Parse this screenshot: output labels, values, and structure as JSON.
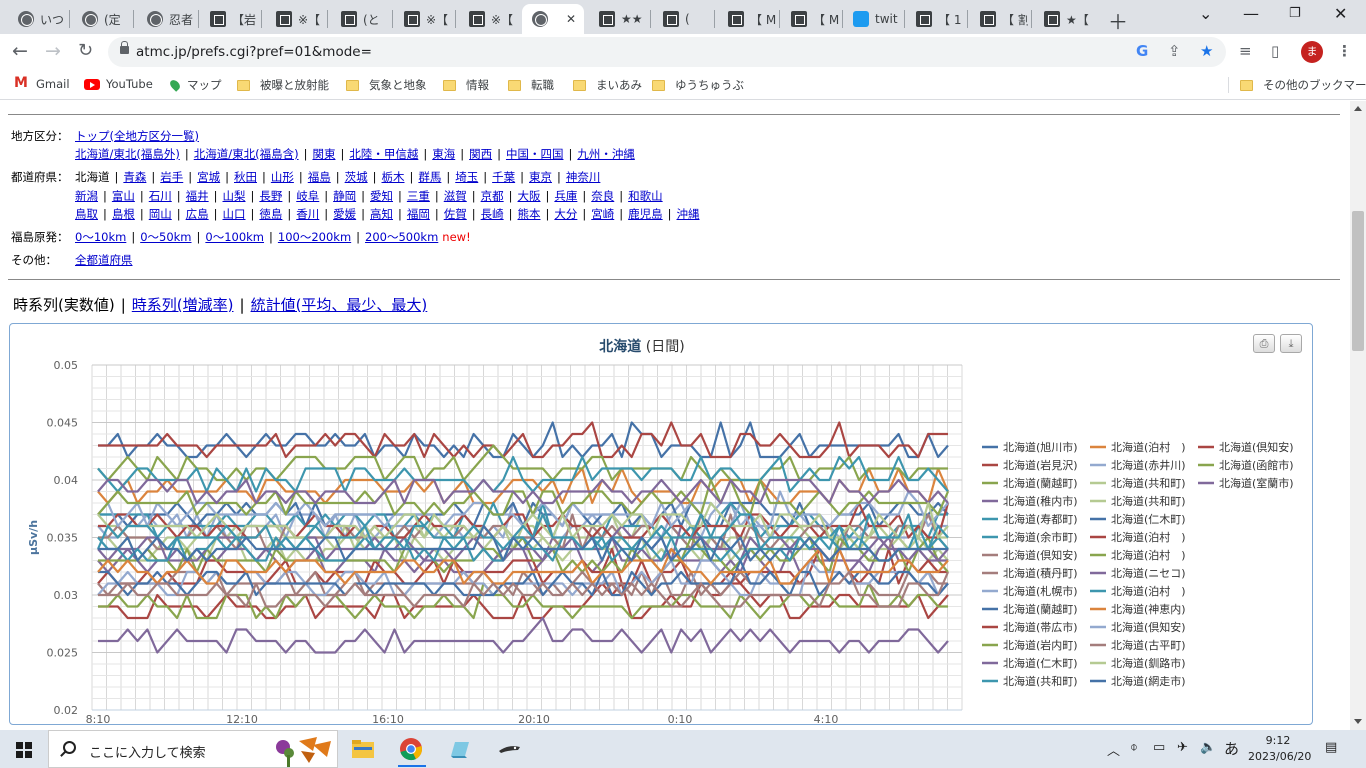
{
  "browser": {
    "tabs": [
      {
        "label": "いつ",
        "icon": "globe-icon"
      },
      {
        "label": "(定",
        "icon": "globe-icon"
      },
      {
        "label": "忍者",
        "icon": "globe-icon"
      },
      {
        "label": "【岩",
        "icon": "site-icon"
      },
      {
        "label": "※【",
        "icon": "site-icon"
      },
      {
        "label": "(と",
        "icon": "site-icon"
      },
      {
        "label": "※【",
        "icon": "site-icon"
      },
      {
        "label": "※【",
        "icon": "site-icon"
      },
      {
        "label": "",
        "icon": "globe-icon",
        "active": true
      },
      {
        "label": "★★",
        "icon": "site-icon"
      },
      {
        "label": "(",
        "icon": "site-icon"
      },
      {
        "label": "【 M",
        "icon": "site-icon"
      },
      {
        "label": "【 M",
        "icon": "site-icon"
      },
      {
        "label": "twit",
        "icon": "twitter-icon"
      },
      {
        "label": "【 1",
        "icon": "site-icon"
      },
      {
        "label": "【 割",
        "icon": "site-icon"
      },
      {
        "label": "★【",
        "icon": "site-icon"
      }
    ],
    "url": "atmc.jp/prefs.cgi?pref=01&mode=",
    "bookmarks": [
      {
        "label": "Gmail",
        "icon": "gmail-icon"
      },
      {
        "label": "YouTube",
        "icon": "youtube-icon"
      },
      {
        "label": "マップ",
        "icon": "maps-icon"
      },
      {
        "label": "被曝と放射能",
        "icon": "folder-icon"
      },
      {
        "label": "気象と地象",
        "icon": "folder-icon"
      },
      {
        "label": "情報",
        "icon": "folder-icon"
      },
      {
        "label": "転職",
        "icon": "folder-icon"
      },
      {
        "label": "まいあみ",
        "icon": "folder-icon"
      },
      {
        "label": "ゆうちゅうぶ",
        "icon": "folder-icon"
      }
    ],
    "other_bookmarks": "その他のブックマーク",
    "avatar_letter": "ま"
  },
  "page": {
    "region": {
      "label": "地方区分：",
      "top_link": "トップ(全地方区分一覧)",
      "links": [
        "北海道/東北(福島外)",
        "北海道/東北(福島含)",
        "関東",
        "北陸・甲信越",
        "東海",
        "関西",
        "中国・四国",
        "九州・沖縄"
      ]
    },
    "prefs": {
      "label": "都道府県：",
      "current": "北海道",
      "row1": [
        "青森",
        "岩手",
        "宮城",
        "秋田",
        "山形",
        "福島",
        "茨城",
        "栃木",
        "群馬",
        "埼玉",
        "千葉",
        "東京",
        "神奈川"
      ],
      "row2": [
        "新潟",
        "富山",
        "石川",
        "福井",
        "山梨",
        "長野",
        "岐阜",
        "静岡",
        "愛知",
        "三重",
        "滋賀",
        "京都",
        "大阪",
        "兵庫",
        "奈良",
        "和歌山"
      ],
      "row3": [
        "鳥取",
        "島根",
        "岡山",
        "広島",
        "山口",
        "徳島",
        "香川",
        "愛媛",
        "高知",
        "福岡",
        "佐賀",
        "長崎",
        "熊本",
        "大分",
        "宮崎",
        "鹿児島",
        "沖縄"
      ]
    },
    "fukushima": {
      "label": "福島原発：",
      "links": [
        "0～10km",
        "0～50km",
        "0～100km",
        "100～200km",
        "200～500km"
      ],
      "new_badge": "new!"
    },
    "other": {
      "label": "その他：",
      "link": "全都道府県"
    },
    "subnav": {
      "current": "時系列(実数値)",
      "link1": "時系列(増減率)",
      "link2": "統計値(平均、最少、最大)"
    }
  },
  "chart_data": {
    "type": "line",
    "title": "北海道",
    "subtitle": "(日間)",
    "ylabel": "μSv/h",
    "ylim": [
      0.02,
      0.05
    ],
    "yticks": [
      "0.02",
      "0.025",
      "0.03",
      "0.035",
      "0.04",
      "0.045",
      "0.05"
    ],
    "xticks": [
      "8:10",
      "12:10",
      "16:10",
      "20:10",
      "0:10",
      "4:10"
    ],
    "grid": true,
    "legend_position": "right",
    "series": [
      {
        "name": "北海道(旭川市)",
        "color": "#4572a7",
        "base": 0.043
      },
      {
        "name": "北海道(泊村　)",
        "color": "#db843d",
        "base": 0.039
      },
      {
        "name": "北海道(倶知安)",
        "color": "#aa4643",
        "base": 0.043
      },
      {
        "name": "北海道(岩見沢)",
        "color": "#aa4643",
        "base": 0.029
      },
      {
        "name": "北海道(赤井川)",
        "color": "#93a9cf",
        "base": 0.036
      },
      {
        "name": "北海道(函館市)",
        "color": "#89a54e",
        "base": 0.041
      },
      {
        "name": "北海道(蘭越町)",
        "color": "#89a54e",
        "base": 0.029
      },
      {
        "name": "北海道(共和町)",
        "color": "#b5ca92",
        "base": 0.034
      },
      {
        "name": "北海道(室蘭市)",
        "color": "#80699b",
        "base": 0.033
      },
      {
        "name": "北海道(稚内市)",
        "color": "#80699b",
        "base": 0.026
      },
      {
        "name": "北海道(共和町)",
        "color": "#b5ca92",
        "base": 0.035
      },
      {
        "name": "北海道(寿都町)",
        "color": "#3d96ae",
        "base": 0.04
      },
      {
        "name": "北海道(仁木町)",
        "color": "#4572a7",
        "base": 0.037
      },
      {
        "name": "北海道(余市町)",
        "color": "#3d96ae",
        "base": 0.036
      },
      {
        "name": "北海道(泊村　)",
        "color": "#aa4643",
        "base": 0.032
      },
      {
        "name": "北海道(倶知安)",
        "color": "#a47d7c",
        "base": 0.035
      },
      {
        "name": "北海道(泊村　)",
        "color": "#89a54e",
        "base": 0.033
      },
      {
        "name": "北海道(積丹町)",
        "color": "#a47d7c",
        "base": 0.031
      },
      {
        "name": "北海道(ニセコ)",
        "color": "#80699b",
        "base": 0.034
      },
      {
        "name": "北海道(札幌市)",
        "color": "#93a9cf",
        "base": 0.031
      },
      {
        "name": "北海道(泊村　)",
        "color": "#3d96ae",
        "base": 0.034
      },
      {
        "name": "北海道(蘭越町)",
        "color": "#4572a7",
        "base": 0.031
      },
      {
        "name": "北海道(神恵内)",
        "color": "#db843d",
        "base": 0.032
      },
      {
        "name": "北海道(帯広市)",
        "color": "#aa4643",
        "base": 0.036
      },
      {
        "name": "北海道(倶知安)",
        "color": "#93a9cf",
        "base": 0.037
      },
      {
        "name": "北海道(岩内町)",
        "color": "#89a54e",
        "base": 0.038
      },
      {
        "name": "北海道(古平町)",
        "color": "#a47d7c",
        "base": 0.03
      },
      {
        "name": "北海道(仁木町)",
        "color": "#80699b",
        "base": 0.039
      },
      {
        "name": "北海道(釧路市)",
        "color": "#b5ca92",
        "base": 0.036
      },
      {
        "name": "北海道(共和町)",
        "color": "#3d96ae",
        "base": 0.035
      },
      {
        "name": "北海道(網走市)",
        "color": "#4572a7",
        "base": 0.034
      }
    ]
  },
  "taskbar": {
    "search_placeholder": "ここに入力して検索",
    "ime": "あ",
    "time": "9:12",
    "date": "2023/06/20"
  }
}
